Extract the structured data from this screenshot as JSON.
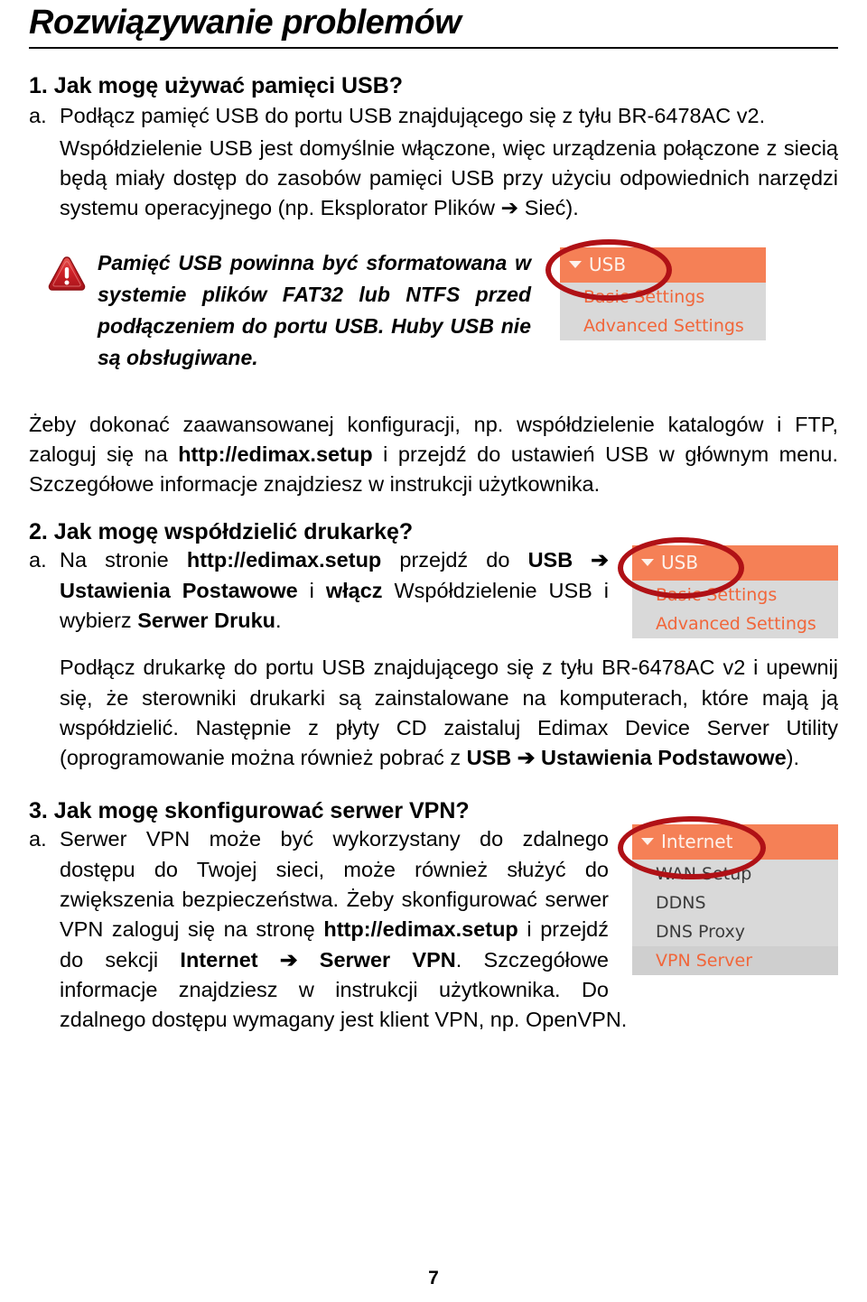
{
  "document": {
    "title": "Rozwiązywanie problemów",
    "page_number": "7"
  },
  "sections": [
    {
      "heading": "1. Jak mogę używać pamięci USB?",
      "marker": "a.",
      "body_line1": "Podłącz pamięć USB do portu USB znajdującego się z tyłu BR-6478AC v2.",
      "body_line2": "Współdzielenie USB jest domyślnie włączone, więc urządzenia połączone z siecią będą miały dostęp do zasobów pamięci USB przy użyciu odpowiednich narzędzi systemu operacyjnego (np. Eksplorator Plików ➔ Sieć)."
    },
    {
      "heading": "2. Jak mogę współdzielić drukarkę?",
      "marker": "a.",
      "part1": "Na stronie ",
      "bold1": "http://edimax.setup",
      "part2": " przejdź do ",
      "bold2": "USB ➔ Ustawienia Postawowe",
      "part3": " i ",
      "bold3": "włącz",
      "part4": " Współdzielenie USB i wybierz ",
      "bold4": "Serwer Druku",
      "part5": ".",
      "paragraph_part1": "Podłącz drukarkę do portu USB znajdującego się z tyłu BR-6478AC v2 i upewnij się, że sterowniki drukarki są zainstalowane na komputerach, które mają ją współdzielić. Następnie z płyty CD zaistaluj Edimax Device Server Utility (oprogramowanie można również pobrać z ",
      "paragraph_bold": "USB ➔ Ustawienia Podstawowe",
      "paragraph_part2": ")."
    },
    {
      "heading": "3. Jak mogę skonfigurować serwer VPN?",
      "marker": "a.",
      "part1": "Serwer VPN może być wykorzystany do zdalnego dostępu do Twojej sieci, może również służyć do zwiększenia bezpieczeństwa. Żeby skonfigurować serwer VPN zaloguj się na stronę ",
      "bold1": "http://edimax.setup",
      "part2": " i przejdź do sekcji ",
      "bold2": "Internet ➔ Serwer VPN",
      "part3": ". Szczegółowe informacje znajdziesz w instrukcji użytkownika. Do zdalnego dostępu wymagany jest klient VPN, np. OpenVPN."
    }
  ],
  "intro_paragraph": {
    "part1": "Żeby dokonać zaawansowanej konfiguracji, np. współdzielenie katalogów i FTP, zaloguj się na ",
    "bold1": "http://edimax.setup",
    "part2": " i przejdź do ustawień USB w głównym menu. Szczegółowe informacje znajdziesz w instrukcji użytkownika."
  },
  "warning": {
    "icon": "warning-triangle-icon",
    "text": "Pamięć USB powinna być sformatowana w systemie plików FAT32 lub NTFS przed podłączeniem do portu USB. Huby USB nie są obsługiwane."
  },
  "menus": {
    "usb": {
      "header": "USB",
      "items": [
        {
          "label": "Basic Settings",
          "selected": false
        },
        {
          "label": "Advanced Settings",
          "selected": false
        }
      ]
    },
    "internet": {
      "header": "Internet",
      "items": [
        {
          "label": "WAN Setup",
          "selected": false
        },
        {
          "label": "DDNS",
          "selected": false
        },
        {
          "label": "DNS Proxy",
          "selected": false
        },
        {
          "label": "VPN Server",
          "selected": true
        }
      ]
    }
  },
  "colors": {
    "menu_header_orange": "#f58056",
    "menu_background_gray": "#d9d9d9",
    "menu_selected_gray": "#cfcfcf",
    "menu_link_orange": "#f1663a",
    "annotation_red": "#b01116",
    "warning_icon_red": "#c1272d"
  }
}
